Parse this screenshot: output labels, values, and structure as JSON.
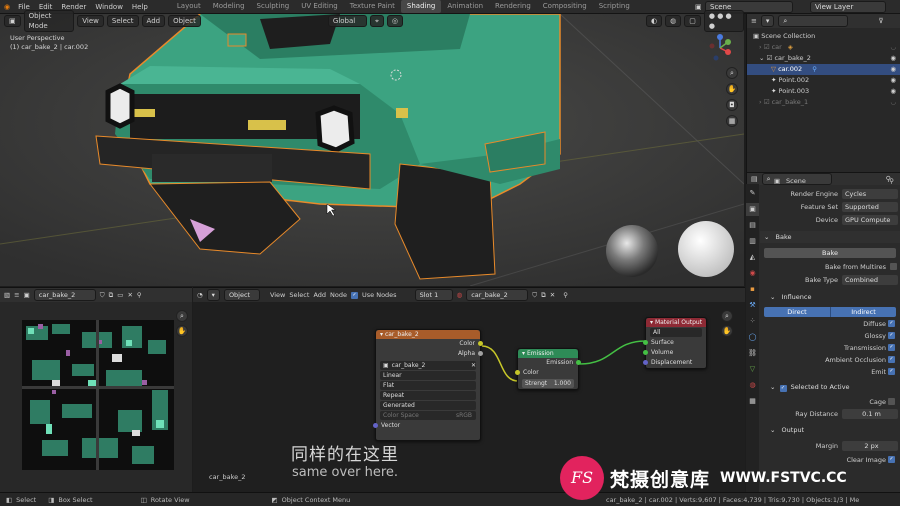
{
  "topbar": {
    "menus": [
      "File",
      "Edit",
      "Render",
      "Window",
      "Help"
    ],
    "workspaces": [
      "Layout",
      "Modeling",
      "Sculpting",
      "UV Editing",
      "Texture Paint",
      "Shading",
      "Animation",
      "Rendering",
      "Compositing",
      "Scripting"
    ],
    "active_workspace": "Shading",
    "scene": "Scene",
    "view_layer": "View Layer"
  },
  "viewport": {
    "mode": "Object Mode",
    "menus": [
      "View",
      "Select",
      "Add",
      "Object"
    ],
    "transform": "Global",
    "perspective": "User Perspective",
    "object_info": "(1) car_bake_2 | car.002"
  },
  "outliner": {
    "title": "Scene Collection",
    "items": [
      {
        "label": "car"
      },
      {
        "label": "car_bake_2"
      },
      {
        "label": "car.002"
      },
      {
        "label": "Point.002"
      },
      {
        "label": "Point.003"
      },
      {
        "label": "car_bake_1"
      }
    ]
  },
  "properties": {
    "scene": "Scene",
    "render_engine_label": "Render Engine",
    "render_engine": "Cycles",
    "feature_set_label": "Feature Set",
    "feature_set": "Supported",
    "device_label": "Device",
    "device": "GPU Compute",
    "bake_section": "Bake",
    "bake_button": "Bake",
    "bake_from_multires": "Bake from Multires",
    "bake_type_label": "Bake Type",
    "bake_type": "Combined",
    "influence": "Influence",
    "direct": "Direct",
    "indirect": "Indirect",
    "diffuse": "Diffuse",
    "glossy": "Glossy",
    "transmission": "Transmission",
    "ambient_occlusion": "Ambient Occlusion",
    "emit": "Emit",
    "selected_to_active": "Selected to Active",
    "cage": "Cage",
    "ray_distance_label": "Ray Distance",
    "ray_distance": "0.1 m",
    "output": "Output",
    "margin_label": "Margin",
    "margin": "2 px",
    "clear_image": "Clear Image"
  },
  "image_editor": {
    "image_name": "car_bake_2"
  },
  "node_editor": {
    "object": "Object",
    "menus": [
      "View",
      "Select",
      "Add",
      "Node"
    ],
    "use_nodes": "Use Nodes",
    "slot": "Slot 1",
    "material": "car_bake_2",
    "footer_name": "car_bake_2",
    "image_node": {
      "title": "car_bake_2",
      "color": "Color",
      "alpha": "Alpha",
      "image": "car_bake_2",
      "interpolation": "Linear",
      "projection": "Flat",
      "extension": "Repeat",
      "source": "Generated",
      "color_space_label": "Color Space",
      "color_space": "sRGB",
      "vector": "Vector"
    },
    "emission_node": {
      "title": "Emission",
      "emission": "Emission",
      "color": "Color",
      "strength_label": "Strengt",
      "strength": "1.000"
    },
    "output_node": {
      "title": "Material Output",
      "target": "All",
      "surface": "Surface",
      "volume": "Volume",
      "displacement": "Displacement"
    }
  },
  "statusbar": {
    "select": "Select",
    "box_select": "Box Select",
    "rotate_view": "Rotate View",
    "context_menu": "Object Context Menu",
    "stats": "car_bake_2 | car.002 | Verts:9,607 | Faces:4,739 | Tris:9,730 | Objects:1/3 | Me"
  },
  "subtitles": {
    "cn": "同样的在这里",
    "en": "same over here."
  },
  "watermark": {
    "logo": "FS",
    "text": "梵摄创意库",
    "url": "WWW.FSTVC.CC"
  },
  "colors": {
    "accent": "#4772b3",
    "image_node": "#a85c2a",
    "shader_node": "#2e8b57",
    "output_node": "#8e2a35",
    "car": "#3ca381"
  }
}
